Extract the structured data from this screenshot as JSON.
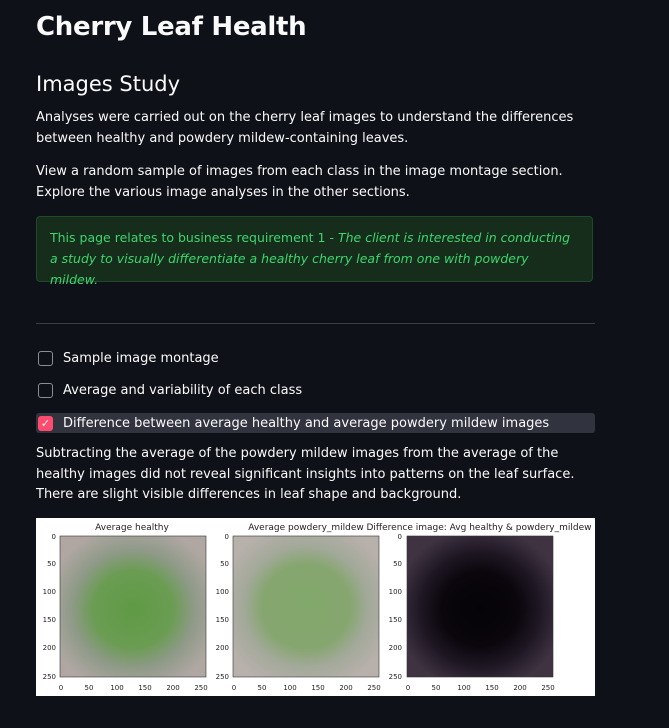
{
  "page_title": "Cherry Leaf Health",
  "section_title": "Images Study",
  "intro": "Analyses were carried out on the cherry leaf images to understand the differences between healthy and powdery mildew-containing leaves.",
  "instructions": "View a random sample of images from each class in the image montage section. Explore the various image analyses in the other sections.",
  "info": {
    "prefix": "This page relates to business requirement 1 - ",
    "emphasis": "The client is interested in conducting a study to visually differentiate a healthy cherry leaf from one with powdery mildew."
  },
  "checkboxes": [
    {
      "label": "Sample image montage",
      "checked": false
    },
    {
      "label": "Average and variability of each class",
      "checked": false
    },
    {
      "label": "Difference between average healthy and average powdery mildew images",
      "checked": true
    }
  ],
  "result_text": "Subtracting the average of the powdery mildew images from the average of the healthy images did not reveal significant insights into patterns on the leaf surface. There are slight visible differences in leaf shape and background.",
  "figure": {
    "panels": [
      {
        "title": "Average healthy"
      },
      {
        "title": "Average powdery_mildew"
      },
      {
        "title": "Difference image: Avg healthy & powdery_mildew"
      }
    ],
    "x_ticks": [
      "0",
      "50",
      "100",
      "150",
      "200",
      "250"
    ],
    "y_ticks": [
      "0",
      "50",
      "100",
      "150",
      "200",
      "250"
    ]
  },
  "colors": {
    "accent": "#ff4b6e",
    "info_text": "#3dd56d",
    "info_bg": "#172d1c",
    "background": "#0e1117"
  },
  "checkmark_icon": "✓"
}
